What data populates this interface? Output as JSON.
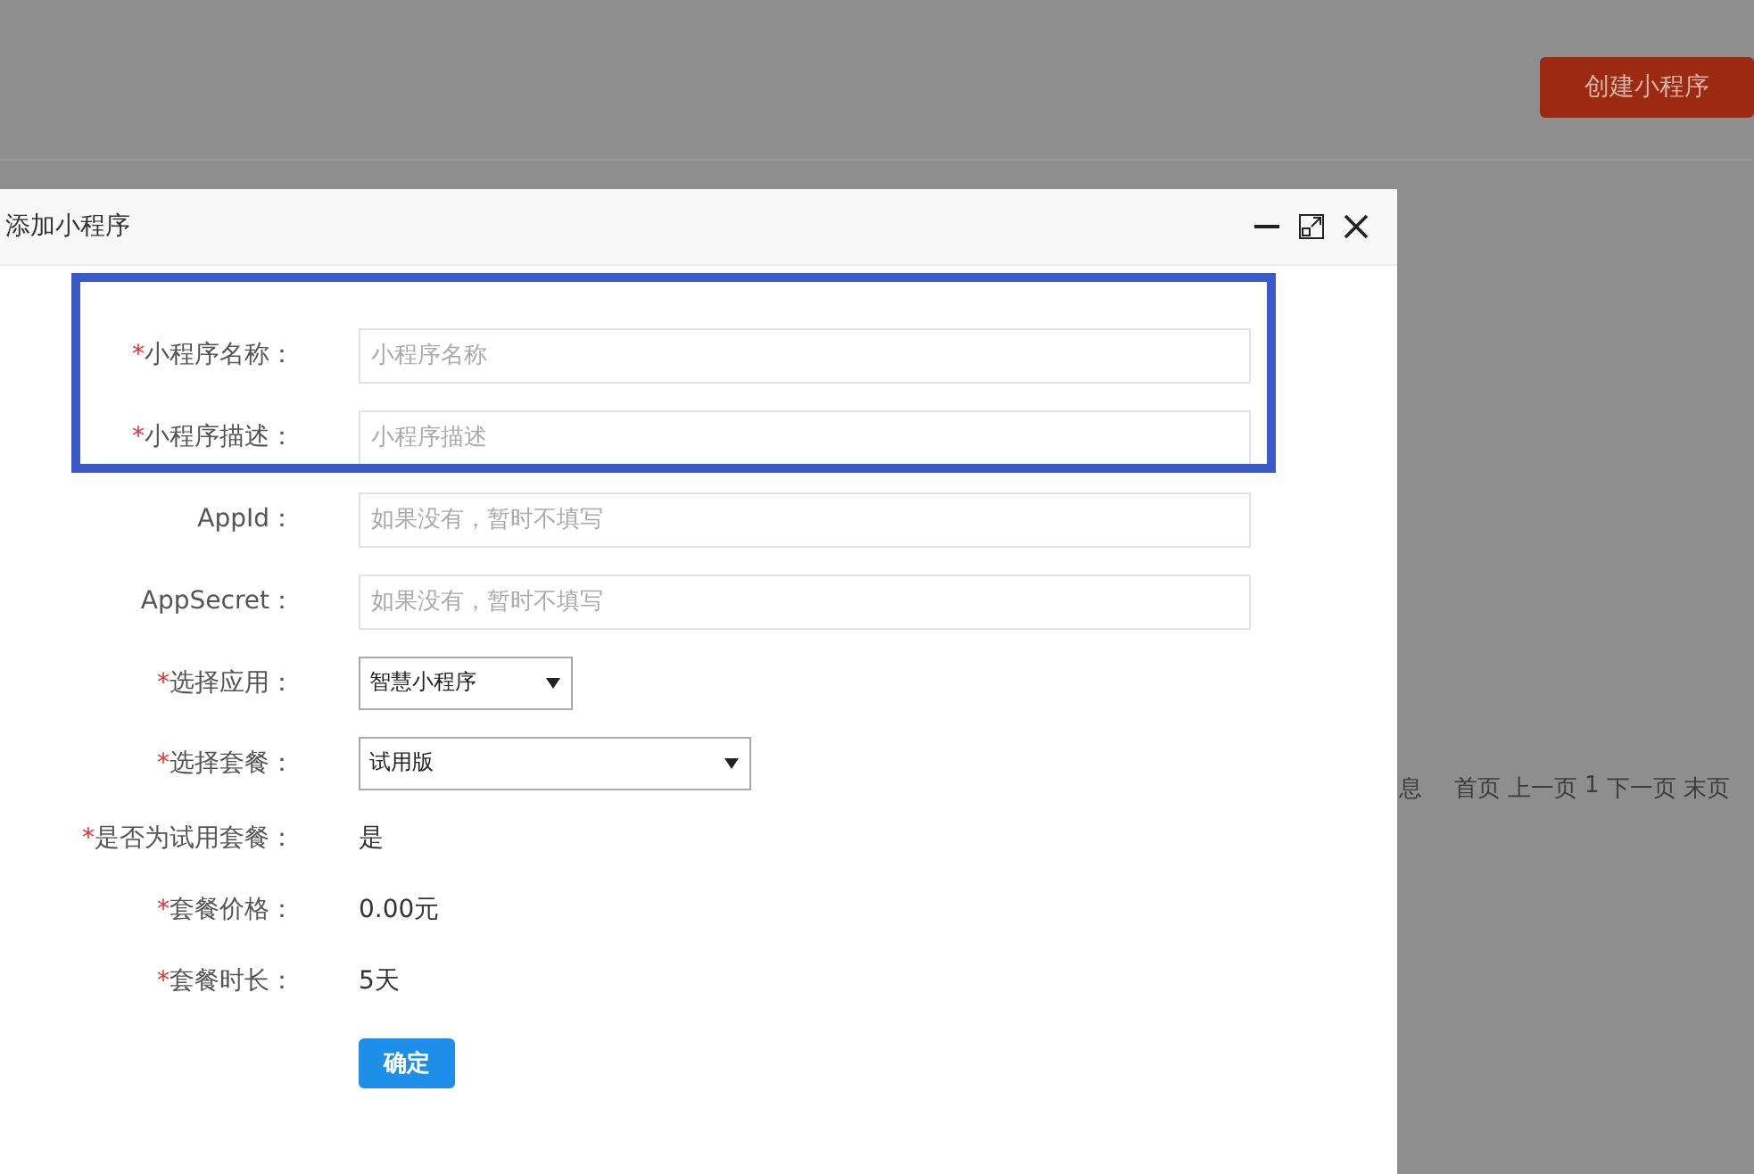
{
  "page": {
    "create_button": "创建小程序",
    "footer_fragment": "息",
    "pagination": [
      "首页",
      "上一页",
      "1",
      "下一页",
      "末页"
    ]
  },
  "dialog": {
    "title": "添加小程序",
    "fields": [
      {
        "kind": "input",
        "mark": "*",
        "label": "小程序名称：",
        "placeholder": "小程序名称"
      },
      {
        "kind": "input",
        "mark": "*",
        "label": "小程序描述：",
        "placeholder": "小程序描述"
      },
      {
        "kind": "input",
        "label": "AppId：",
        "placeholder": "如果没有，暂时不填写"
      },
      {
        "kind": "input",
        "label": "AppSecret：",
        "placeholder": "如果没有，暂时不填写"
      },
      {
        "kind": "select",
        "mark": "*",
        "label": "选择应用：",
        "value": "智慧小程序"
      },
      {
        "kind": "wide-select",
        "mark": "*",
        "label": "选择套餐：",
        "value": "试用版"
      },
      {
        "kind": "text",
        "mark": "*",
        "label": "是否为试用套餐：",
        "value": "是"
      },
      {
        "kind": "text",
        "mark": "*",
        "label": "套餐价格：",
        "value": "0.00元"
      },
      {
        "kind": "text",
        "mark": "*",
        "label": "套餐时长：",
        "value": "5天"
      }
    ],
    "submit": "确定"
  }
}
